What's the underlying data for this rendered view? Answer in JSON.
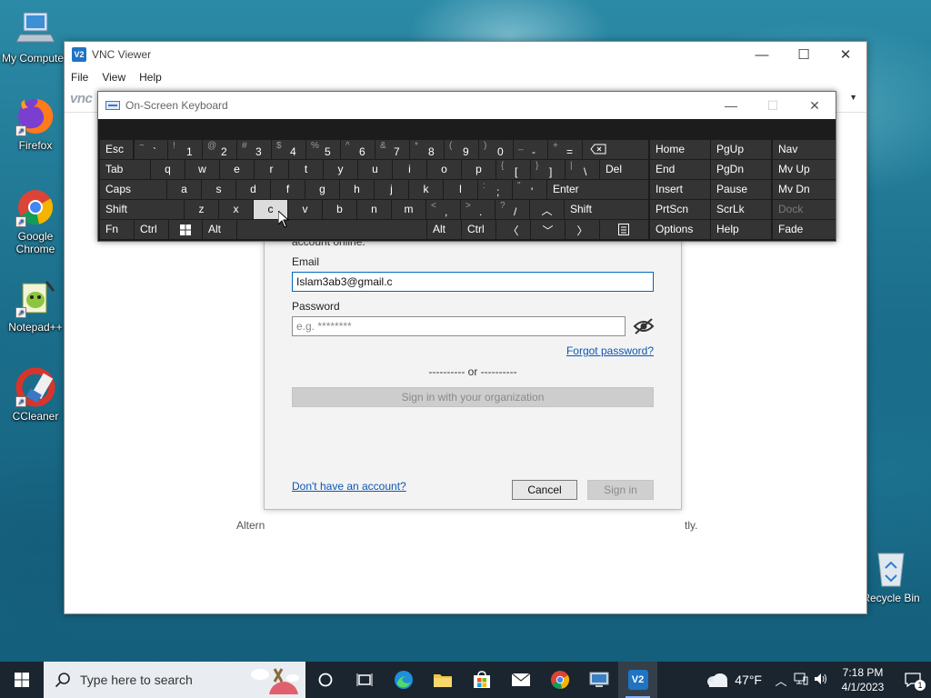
{
  "desktop": {
    "icons": [
      {
        "label": "My Computer"
      },
      {
        "label": "Firefox"
      },
      {
        "label": "Google Chrome"
      },
      {
        "label": "Notepad++"
      },
      {
        "label": "CCleaner"
      }
    ],
    "recycle_bin": {
      "label": "Recycle Bin"
    }
  },
  "vnc": {
    "title": "VNC Viewer",
    "logo_text": "V2",
    "menu": [
      "File",
      "View",
      "Help"
    ],
    "toolbar_brand": "vnc",
    "alt_text_left": "Altern",
    "alt_text_right": "tly."
  },
  "dialog": {
    "partial_text": "account online.",
    "email_label": "Email",
    "email_value": "Islam3ab3@gmail.c",
    "password_label": "Password",
    "password_placeholder": "e.g. ********",
    "forgot_password": "Forgot password?",
    "or_separator": "---------- or ----------",
    "org_button": "Sign in with your organization",
    "no_account": "Don't have an account?",
    "cancel": "Cancel",
    "sign_in": "Sign in"
  },
  "osk": {
    "title": "On-Screen Keyboard",
    "keys": {
      "esc": "Esc",
      "tab": "Tab",
      "caps": "Caps",
      "shift": "Shift",
      "fn": "Fn",
      "ctrl": "Ctrl",
      "alt": "Alt",
      "del": "Del",
      "enter": "Enter",
      "home": "Home",
      "pgup": "PgUp",
      "nav": "Nav",
      "end": "End",
      "pgdn": "PgDn",
      "mvup": "Mv Up",
      "insert": "Insert",
      "pause": "Pause",
      "mvdn": "Mv Dn",
      "prtscn": "PrtScn",
      "scrlk": "ScrLk",
      "dock": "Dock",
      "options": "Options",
      "help": "Help",
      "fade": "Fade",
      "numbers": [
        {
          "s": "~",
          "m": "`"
        },
        {
          "s": "!",
          "m": "1"
        },
        {
          "s": "@",
          "m": "2"
        },
        {
          "s": "#",
          "m": "3"
        },
        {
          "s": "$",
          "m": "4"
        },
        {
          "s": "%",
          "m": "5"
        },
        {
          "s": "^",
          "m": "6"
        },
        {
          "s": "&",
          "m": "7"
        },
        {
          "s": "*",
          "m": "8"
        },
        {
          "s": "(",
          "m": "9"
        },
        {
          "s": ")",
          "m": "0"
        },
        {
          "s": "_",
          "m": "-"
        },
        {
          "s": "+",
          "m": "="
        }
      ],
      "row_q": [
        "q",
        "w",
        "e",
        "r",
        "t",
        "y",
        "u",
        "i",
        "o",
        "p"
      ],
      "row_q_sym": [
        {
          "s": "{",
          "m": "["
        },
        {
          "s": "}",
          "m": "]"
        },
        {
          "s": "|",
          "m": "\\"
        }
      ],
      "row_a": [
        "a",
        "s",
        "d",
        "f",
        "g",
        "h",
        "j",
        "k",
        "l"
      ],
      "row_a_sym": [
        {
          "s": ":",
          "m": ";"
        },
        {
          "s": "\"",
          "m": "'"
        }
      ],
      "row_z": [
        "z",
        "x",
        "c",
        "v",
        "b",
        "n",
        "m"
      ],
      "row_z_sym": [
        {
          "s": "<",
          "m": ","
        },
        {
          "s": ">",
          "m": "."
        },
        {
          "s": "?",
          "m": "/"
        }
      ]
    }
  },
  "taskbar": {
    "search_placeholder": "Type here to search",
    "weather_temp": "47°F",
    "time": "7:18 PM",
    "date": "4/1/2023",
    "notification_count": "1"
  }
}
